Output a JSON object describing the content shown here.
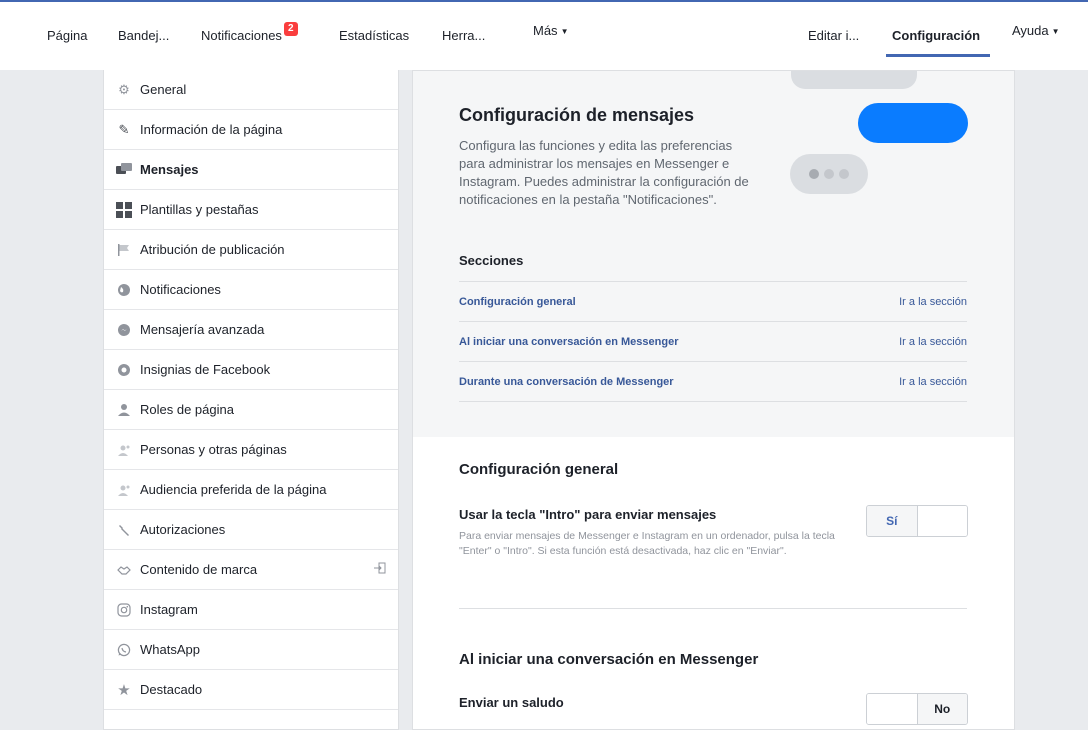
{
  "nav": {
    "left": [
      {
        "label": "Página"
      },
      {
        "label": "Bandej..."
      },
      {
        "label": "Notificaciones",
        "badge": "2"
      },
      {
        "label": "Estadísticas"
      },
      {
        "label": "Herra..."
      },
      {
        "label": "Más"
      }
    ],
    "right": [
      {
        "label": "Editar i..."
      },
      {
        "label": "Configuración",
        "active": true
      },
      {
        "label": "Ayuda"
      }
    ]
  },
  "sidebar": {
    "items": [
      {
        "label": "General",
        "icon": "gear-icon"
      },
      {
        "label": "Información de la página",
        "icon": "pencil-icon"
      },
      {
        "label": "Mensajes",
        "icon": "chat-icon",
        "active": true
      },
      {
        "label": "Plantillas y pestañas",
        "icon": "grid-icon"
      },
      {
        "label": "Atribución de publicación",
        "icon": "flag-icon"
      },
      {
        "label": "Notificaciones",
        "icon": "globe-icon"
      },
      {
        "label": "Mensajería avanzada",
        "icon": "messenger-icon"
      },
      {
        "label": "Insignias de Facebook",
        "icon": "badge-icon"
      },
      {
        "label": "Roles de página",
        "icon": "person-icon"
      },
      {
        "label": "Personas y otras páginas",
        "icon": "people-icon"
      },
      {
        "label": "Audiencia preferida de la página",
        "icon": "people-icon"
      },
      {
        "label": "Autorizaciones",
        "icon": "wrench-icon"
      },
      {
        "label": "Contenido de marca",
        "icon": "handshake-icon",
        "extra": "external-link-icon"
      },
      {
        "label": "Instagram",
        "icon": "instagram-icon"
      },
      {
        "label": "WhatsApp",
        "icon": "whatsapp-icon"
      },
      {
        "label": "Destacado",
        "icon": "star-icon"
      }
    ]
  },
  "main": {
    "title": "Configuración de mensajes",
    "description": "Configura las funciones y edita las preferencias para administrar los mensajes en Messenger e Instagram. Puedes administrar la configuración de notificaciones en la pestaña \"Notificaciones\".",
    "sections_title": "Secciones",
    "sections": [
      {
        "label": "Configuración general",
        "link": "Ir a la sección"
      },
      {
        "label": "Al iniciar una conversación en Messenger",
        "link": "Ir a la sección"
      },
      {
        "label": "Durante una conversación de Messenger",
        "link": "Ir a la sección"
      }
    ],
    "general": {
      "title": "Configuración general",
      "option_title": "Usar la tecla \"Intro\" para enviar mensajes",
      "option_desc": "Para enviar mensajes de Messenger e Instagram en un ordenador, pulsa la tecla \"Enter\" o \"Intro\". Si esta función está desactivada, haz clic en \"Enviar\".",
      "toggle_value": "Sí"
    },
    "messenger_start": {
      "title": "Al iniciar una conversación en Messenger",
      "option_title": "Enviar un saludo",
      "toggle_value": "No"
    }
  },
  "colors": {
    "accent": "#4267b2",
    "messenger_blue": "#0a7cff",
    "badge": "#fa3e3e",
    "link": "#385898"
  }
}
